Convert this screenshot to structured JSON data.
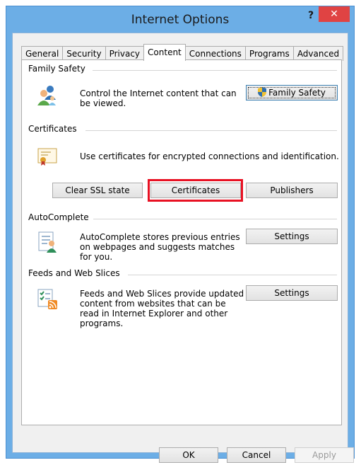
{
  "window": {
    "title": "Internet Options",
    "help_label": "?",
    "close_label": "✕"
  },
  "tabs": [
    "General",
    "Security",
    "Privacy",
    "Content",
    "Connections",
    "Programs",
    "Advanced"
  ],
  "active_tab": "Content",
  "family_safety": {
    "heading": "Family Safety",
    "description_line1": "Control the Internet content that can",
    "description_line2": "be viewed.",
    "button_label": "Family Safety"
  },
  "certificates": {
    "heading": "Certificates",
    "description": "Use certificates for encrypted connections and identification.",
    "clear_ssl_label": "Clear SSL state",
    "certificates_label": "Certificates",
    "publishers_label": "Publishers"
  },
  "autocomplete": {
    "heading": "AutoComplete",
    "description_line1": "AutoComplete stores previous entries",
    "description_line2": "on webpages and suggests matches",
    "description_line3": "for you.",
    "settings_label": "Settings"
  },
  "feeds": {
    "heading": "Feeds and Web Slices",
    "description_line1": "Feeds and Web Slices provide updated",
    "description_line2": "content from websites that can be",
    "description_line3": "read in Internet Explorer and other",
    "description_line4": "programs.",
    "settings_label": "Settings"
  },
  "footer": {
    "ok_label": "OK",
    "cancel_label": "Cancel",
    "apply_label": "Apply"
  },
  "colors": {
    "highlight": "#e81123",
    "titlebar": "#6caee6",
    "close": "#e04343"
  }
}
